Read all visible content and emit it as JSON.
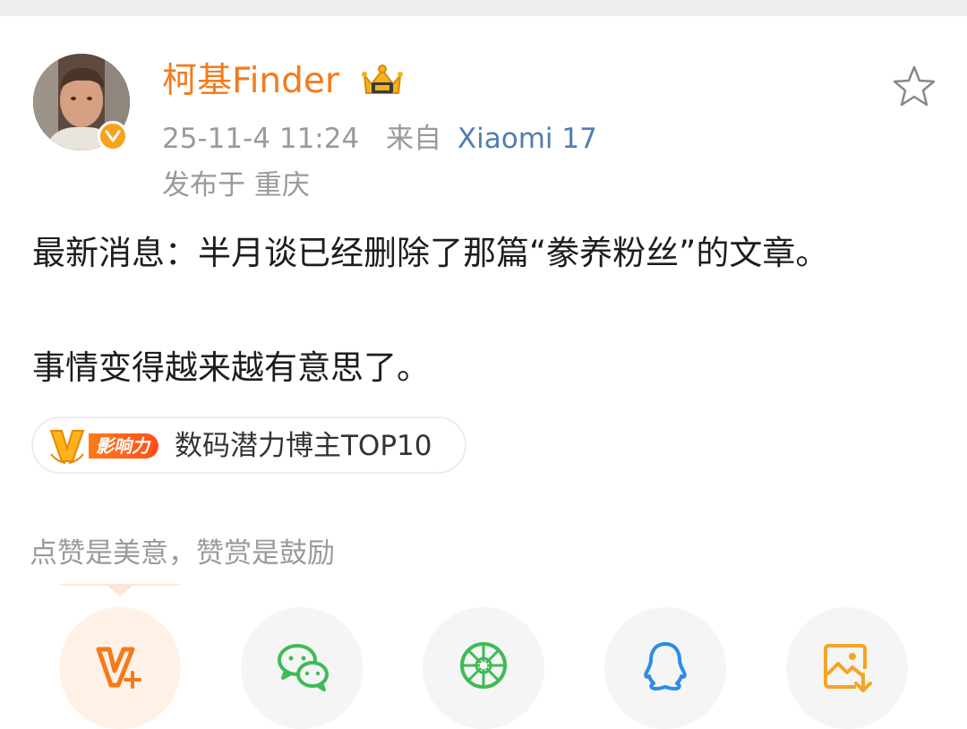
{
  "post": {
    "username": "柯基Finder",
    "time": "25-11-4 11:24",
    "source_prefix": "来自",
    "device": "Xiaomi 17",
    "location": "发布于 重庆",
    "content_line1": "最新消息：半月谈已经删除了那篇“豢养粉丝”的文章。",
    "content_line2": "事情变得越来越有意思了。"
  },
  "badge": {
    "tag": "影响力",
    "text": "数码潜力博主TOP10"
  },
  "appreciate": {
    "prompt": "点赞是美意，赞赏是鼓励"
  },
  "share_buttons": [
    {
      "icon": "vplus-reward-icon",
      "color": "#f37b1d"
    },
    {
      "icon": "wechat-icon",
      "color": "#3fbb55"
    },
    {
      "icon": "moments-icon",
      "color": "#3fbb55"
    },
    {
      "icon": "qq-icon",
      "color": "#2b8ce8"
    },
    {
      "icon": "save-image-icon",
      "color": "#f5a523"
    }
  ],
  "colors": {
    "username": "#f37b1d",
    "device_link": "#4f7db3",
    "meta_gray": "#9a9a9a",
    "badge_orange": "#ff5a1a"
  }
}
